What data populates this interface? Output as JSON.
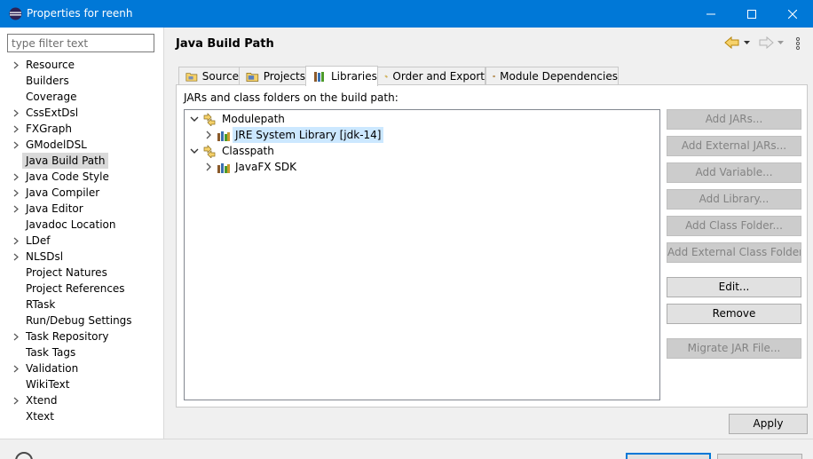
{
  "window": {
    "title": "Properties for reenh",
    "controls": [
      "minimize-icon",
      "maximize-icon",
      "close-icon"
    ]
  },
  "sidebar": {
    "filter_placeholder": "type filter text",
    "items": [
      {
        "label": "Resource",
        "expandable": true
      },
      {
        "label": "Builders",
        "expandable": false
      },
      {
        "label": "Coverage",
        "expandable": false
      },
      {
        "label": "CssExtDsl",
        "expandable": true
      },
      {
        "label": "FXGraph",
        "expandable": true
      },
      {
        "label": "GModelDSL",
        "expandable": true
      },
      {
        "label": "Java Build Path",
        "expandable": false,
        "selected": true
      },
      {
        "label": "Java Code Style",
        "expandable": true
      },
      {
        "label": "Java Compiler",
        "expandable": true
      },
      {
        "label": "Java Editor",
        "expandable": true
      },
      {
        "label": "Javadoc Location",
        "expandable": false
      },
      {
        "label": "LDef",
        "expandable": true
      },
      {
        "label": "NLSDsl",
        "expandable": true
      },
      {
        "label": "Project Natures",
        "expandable": false
      },
      {
        "label": "Project References",
        "expandable": false
      },
      {
        "label": "RTask",
        "expandable": false
      },
      {
        "label": "Run/Debug Settings",
        "expandable": false
      },
      {
        "label": "Task Repository",
        "expandable": true
      },
      {
        "label": "Task Tags",
        "expandable": false
      },
      {
        "label": "Validation",
        "expandable": true
      },
      {
        "label": "WikiText",
        "expandable": false
      },
      {
        "label": "Xtend",
        "expandable": true
      },
      {
        "label": "Xtext",
        "expandable": false
      }
    ]
  },
  "main": {
    "title": "Java Build Path",
    "nav_icons": [
      "back-arrow-icon",
      "back-menu-icon",
      "forward-arrow-icon",
      "forward-menu-icon",
      "view-menu-icon"
    ],
    "tabs": [
      {
        "label": "Source",
        "icon": "source-folder-icon",
        "active": false
      },
      {
        "label": "Projects",
        "icon": "projects-icon",
        "active": false
      },
      {
        "label": "Libraries",
        "icon": "libraries-icon",
        "active": true
      },
      {
        "label": "Order and Export",
        "icon": "order-export-icon",
        "active": false
      },
      {
        "label": "Module Dependencies",
        "icon": "module-dependencies-icon",
        "active": false
      }
    ],
    "description": "JARs and class folders on the build path:",
    "tree": {
      "modulepath": {
        "label": "Modulepath",
        "expanded": true
      },
      "jre": {
        "label": "JRE System Library [jdk-14]",
        "selected": true
      },
      "classpath": {
        "label": "Classpath",
        "expanded": true
      },
      "javafx": {
        "label": "JavaFX SDK"
      }
    },
    "buttons": [
      {
        "label": "Add JARs...",
        "enabled": false
      },
      {
        "label": "Add External JARs...",
        "enabled": false
      },
      {
        "label": "Add Variable...",
        "enabled": false
      },
      {
        "label": "Add Library...",
        "enabled": false
      },
      {
        "label": "Add Class Folder...",
        "enabled": false
      },
      {
        "label": "Add External Class Folder...",
        "enabled": false
      },
      {
        "label": "Edit...",
        "enabled": true
      },
      {
        "label": "Remove",
        "enabled": true
      },
      {
        "label": "Migrate JAR File...",
        "enabled": false
      }
    ],
    "apply_label": "Apply"
  },
  "colors": {
    "titlebar": "#0078d7",
    "selection": "#cce8ff",
    "sidebar_selection": "#d9d9d9",
    "disabled_text": "#838383"
  }
}
